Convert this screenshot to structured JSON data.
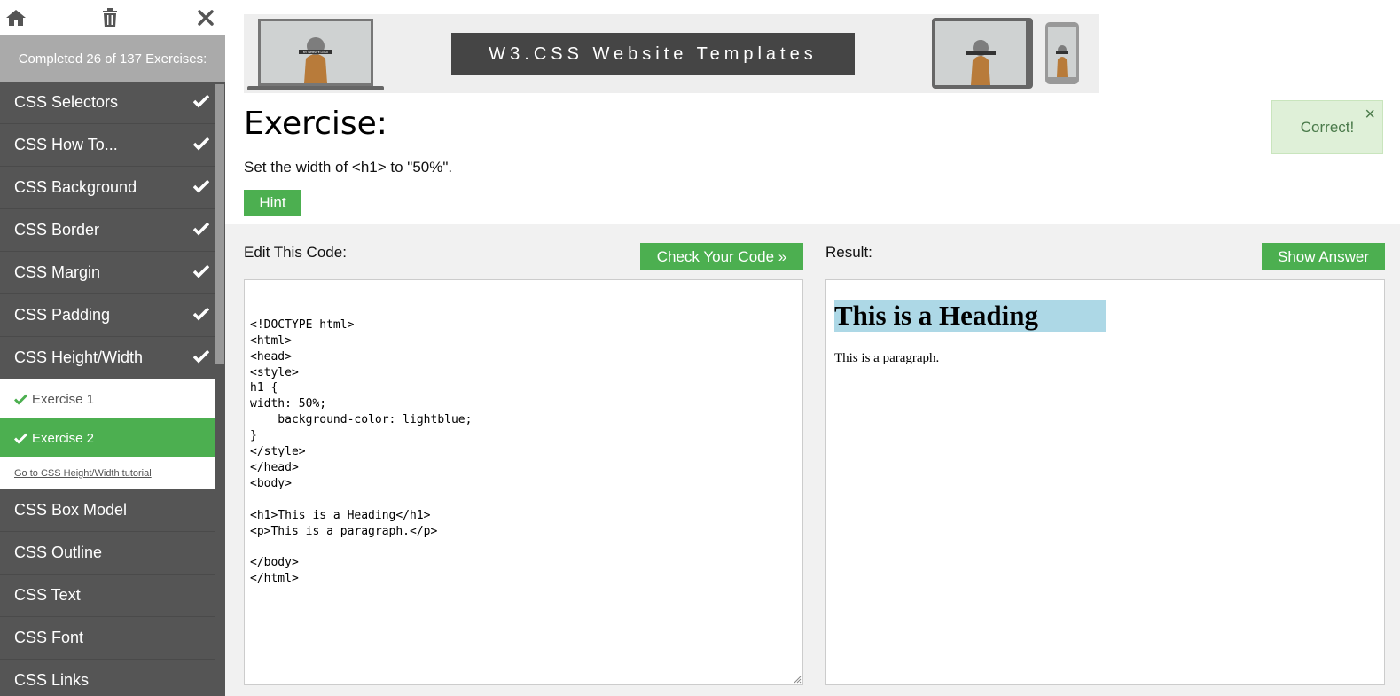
{
  "sidebar": {
    "progress_text": "Completed 26 of 137 Exercises:",
    "items_before": [
      {
        "label": "CSS Selectors"
      },
      {
        "label": "CSS How To..."
      },
      {
        "label": "CSS Background"
      },
      {
        "label": "CSS Border"
      },
      {
        "label": "CSS Margin"
      },
      {
        "label": "CSS Padding"
      },
      {
        "label": "CSS Height/Width"
      }
    ],
    "sub_items": [
      {
        "label": "Exercise 1"
      },
      {
        "label": "Exercise 2"
      }
    ],
    "tutorial_link": "Go to CSS Height/Width tutorial",
    "items_after": [
      {
        "label": "CSS Box Model"
      },
      {
        "label": "CSS Outline"
      },
      {
        "label": "CSS Text"
      },
      {
        "label": "CSS Font"
      },
      {
        "label": "CSS Links"
      }
    ]
  },
  "banner": {
    "title": "W3.CSS Website Templates",
    "mock_caption": "MY WEBSITE LOGO"
  },
  "exercise": {
    "title": "Exercise:",
    "instruction": "Set the width of <h1> to \"50%\".",
    "hint_label": "Hint"
  },
  "toast": {
    "text": "Correct!",
    "close_symbol": "×"
  },
  "editor": {
    "label": "Edit This Code:",
    "check_label": "Check Your Code »",
    "code": "<!DOCTYPE html>\n<html>\n<head>\n<style>\nh1 {\nwidth: 50%;\n    background-color: lightblue;\n}\n</style>\n</head>\n<body>\n\n<h1>This is a Heading</h1>\n<p>This is a paragraph.</p>\n\n</body>\n</html>"
  },
  "result": {
    "label": "Result:",
    "show_answer_label": "Show Answer",
    "heading": "This is a Heading",
    "paragraph": "This is a paragraph."
  },
  "colors": {
    "accent": "#4CAF50",
    "sidebar_bg": "#555555",
    "result_heading_bg": "lightblue"
  }
}
